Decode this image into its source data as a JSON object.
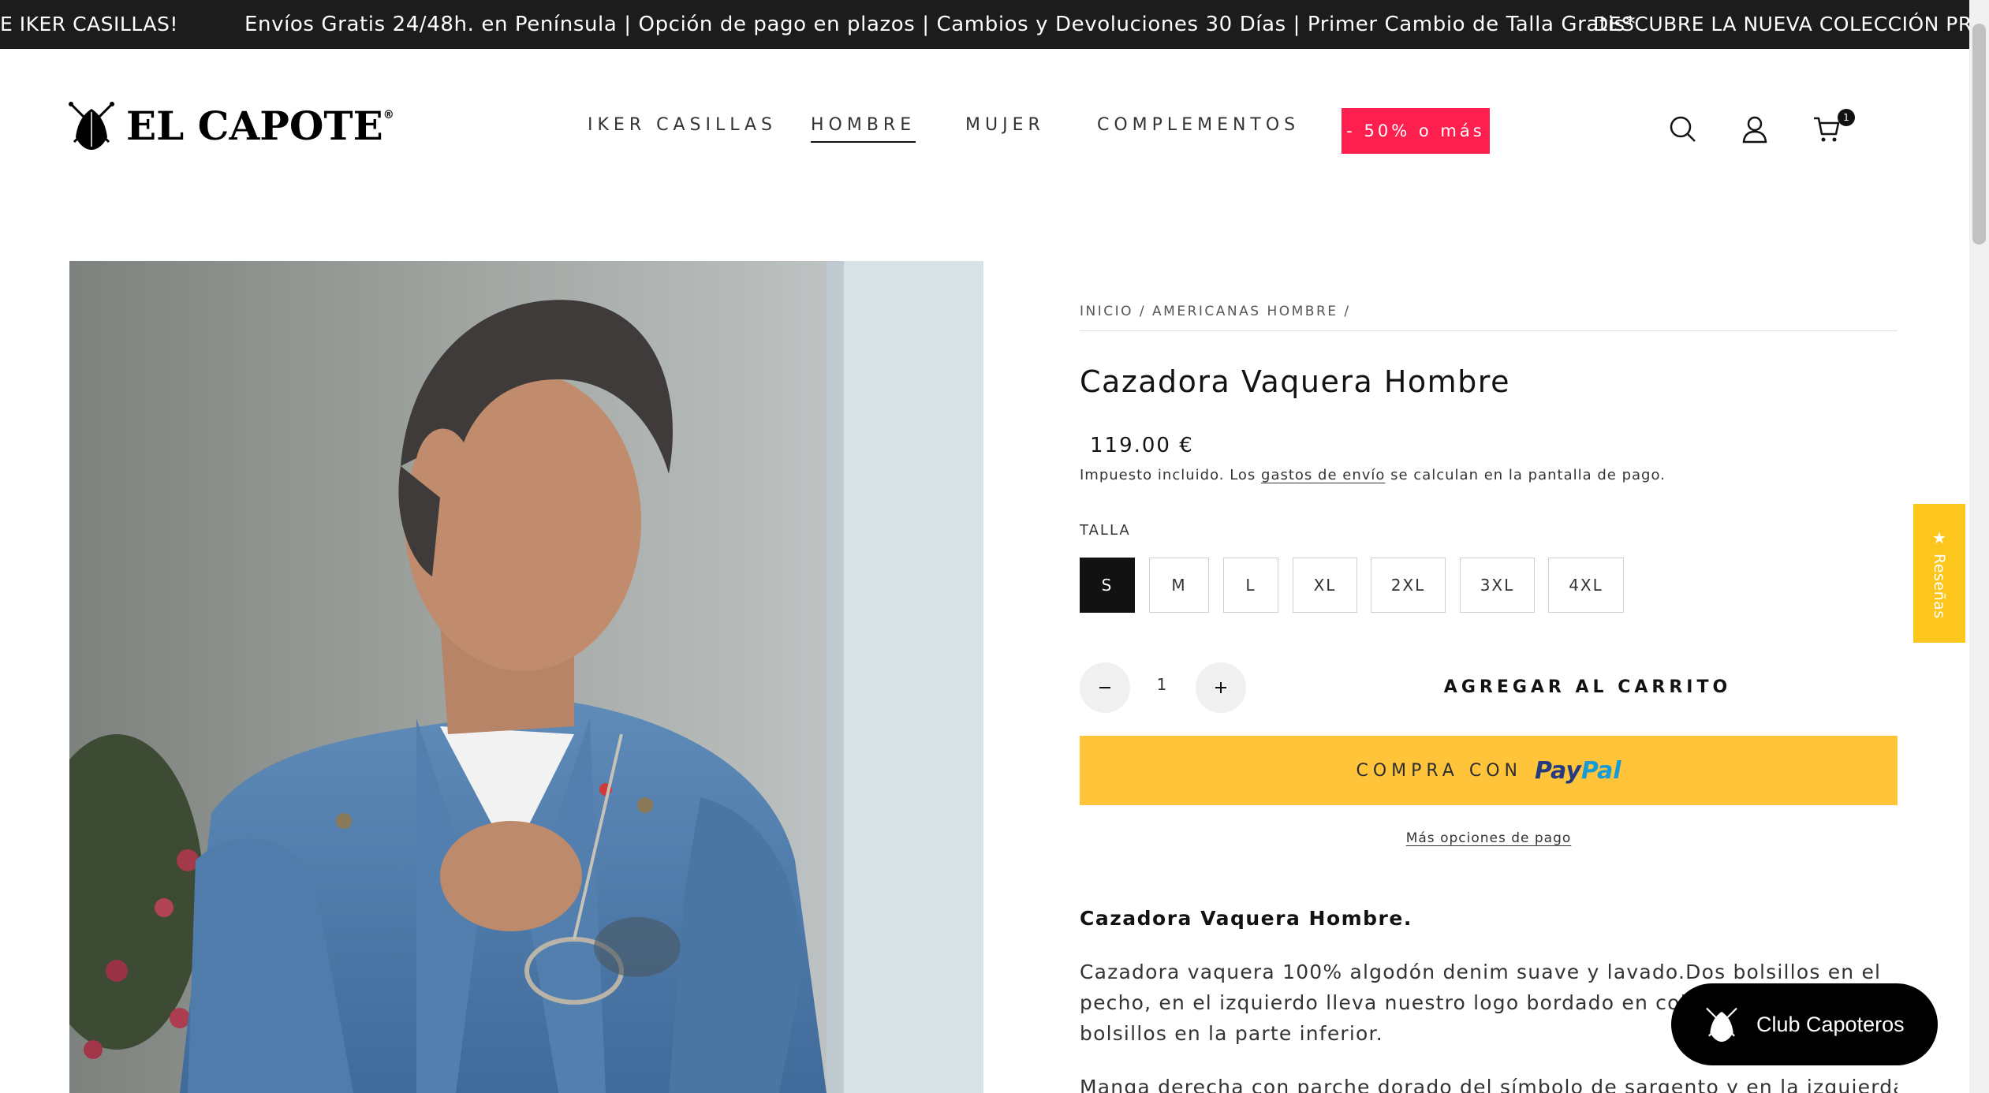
{
  "announcement": {
    "left_text": "E IKER CASILLAS!",
    "main_text": "Envíos Gratis 24/48h. en Península | Opción de pago en plazos | Cambios y Devoluciones 30 Días | Primer Cambio de Talla Gratis*",
    "right_text": "DESCUBRE LA NUEVA COLECCIÓN PRIMAVE"
  },
  "header": {
    "logo_text": "EL CAPOTE",
    "logo_reg": "®",
    "logo_icon": "el-capote-logo-icon",
    "nav": [
      {
        "label": "IKER CASILLAS",
        "active": false
      },
      {
        "label": "HOMBRE",
        "active": true
      },
      {
        "label": "MUJER",
        "active": false
      },
      {
        "label": "COMPLEMENTOS",
        "active": false
      }
    ],
    "sale_label": "- 50% o más",
    "sale_color": "#ff1f4e",
    "icons": [
      "search-icon",
      "account-icon",
      "cart-icon"
    ],
    "cart_count": "1"
  },
  "product": {
    "image_alt": "man-in-denim-jacket-photo",
    "breadcrumb": "INICIO / AMERICANAS HOMBRE /",
    "title": "Cazadora Vaquera Hombre",
    "price": "119.00 €",
    "tax_note": {
      "before": "Impuesto incluido. Los ",
      "link": "gastos de envío",
      "after": " se calculan en la pantalla de pago."
    },
    "size_label": "TALLA",
    "sizes": [
      {
        "label": "S",
        "selected": true
      },
      {
        "label": "M",
        "selected": false
      },
      {
        "label": "L",
        "selected": false
      },
      {
        "label": "XL",
        "selected": false
      },
      {
        "label": "2XL",
        "selected": false
      },
      {
        "label": "3XL",
        "selected": false
      },
      {
        "label": "4XL",
        "selected": false
      }
    ],
    "quantity": "1",
    "add_to_cart": "AGREGAR AL CARRITO",
    "paypal": {
      "prefix": "COMPRA CON",
      "pay": "Pay",
      "pal": "Pal",
      "color": "#ffc439"
    },
    "more_payment": "Más opciones de pago",
    "description": {
      "heading": "Cazadora Vaquera Hombre.",
      "p1": "Cazadora vaquera 100% algodón denim suave y lavado.Dos bolsillos en el pecho, en el izquierdo lleva nuestro logo bordado en color rojo , y dos bolsillos en la parte inferior.",
      "p2": "Manga derecha con parche dorado del símbolo de sargento y en la izquierda parche de"
    }
  },
  "reviews_tab": {
    "label": "Reseñas",
    "star": "★",
    "color": "#fcc61c"
  },
  "club_popup": {
    "label": "Club Capoteros"
  }
}
